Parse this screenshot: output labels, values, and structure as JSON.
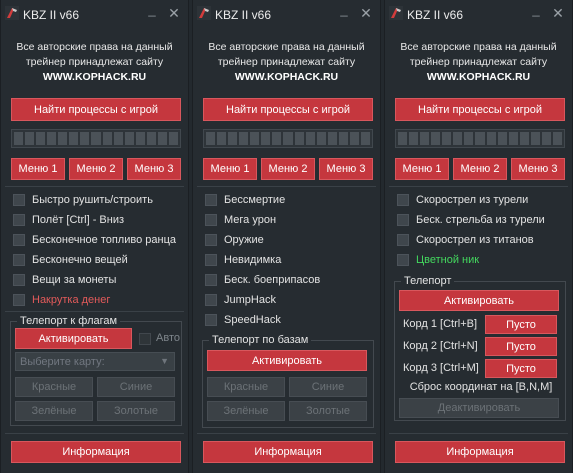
{
  "window_title": "KBZ II v66",
  "title_controls": {
    "minimize": "_",
    "close": "✕"
  },
  "copyright": {
    "line1": "Все авторские права на данный",
    "line2": "трейнер принадлежат сайту",
    "site": "WWW.KOPHACK.RU"
  },
  "find_process_button": "Найти процессы с игрой",
  "progress_segments": 15,
  "menu_tabs": [
    "Меню 1",
    "Меню 2",
    "Меню 3"
  ],
  "info_button": "Информация",
  "colors": {
    "accent": "#c5373e",
    "background": "#262c31",
    "red_text": "#e25a5a",
    "green_text": "#43d85e"
  },
  "panel1": {
    "options": [
      {
        "label": "Быстро рушить/строить",
        "checked": false
      },
      {
        "label": "Полёт [Ctrl] - Вниз",
        "checked": false
      },
      {
        "label": "Бесконечное топливо ранца",
        "checked": false
      },
      {
        "label": "Бесконечно вещей",
        "checked": false
      },
      {
        "label": "Вещи за монеты",
        "checked": false
      },
      {
        "label": "Накрутка денег",
        "checked": false,
        "color": "red"
      }
    ],
    "teleport_flags": {
      "title": "Телепорт к флагам",
      "activate": "Активировать",
      "auto_label": "Авто",
      "select_placeholder": "Выберите карту:",
      "buttons": [
        "Красные",
        "Синие",
        "Зелёные",
        "Золотые"
      ]
    }
  },
  "panel2": {
    "options": [
      {
        "label": "Бессмертие",
        "checked": false
      },
      {
        "label": "Мега урон",
        "checked": false
      },
      {
        "label": "Оружие",
        "checked": false
      },
      {
        "label": "Невидимка",
        "checked": false
      },
      {
        "label": "Беск. боеприпасов",
        "checked": false
      },
      {
        "label": "JumpHack",
        "checked": false
      },
      {
        "label": "SpeedHack",
        "checked": false
      }
    ],
    "teleport_bases": {
      "title": "Телепорт по базам",
      "activate": "Активировать",
      "buttons": [
        "Красные",
        "Синие",
        "Зелёные",
        "Золотые"
      ]
    }
  },
  "panel3": {
    "options": [
      {
        "label": "Скорострел из турели",
        "checked": false
      },
      {
        "label": "Беск. стрельба из турели",
        "checked": false
      },
      {
        "label": "Скорострел из титанов",
        "checked": false
      },
      {
        "label": "Цветной ник",
        "checked": false,
        "color": "green"
      }
    ],
    "teleport": {
      "title": "Телепорт",
      "activate": "Активировать",
      "coords": [
        {
          "label": "Корд 1 [Ctrl+B]",
          "value": "Пусто"
        },
        {
          "label": "Корд 2 [Ctrl+N]",
          "value": "Пусто"
        },
        {
          "label": "Корд 3 [Ctrl+M]",
          "value": "Пусто"
        }
      ],
      "reset_note": "Сброс координат на [B,N,M]",
      "deactivate": "Деактивировать"
    }
  }
}
